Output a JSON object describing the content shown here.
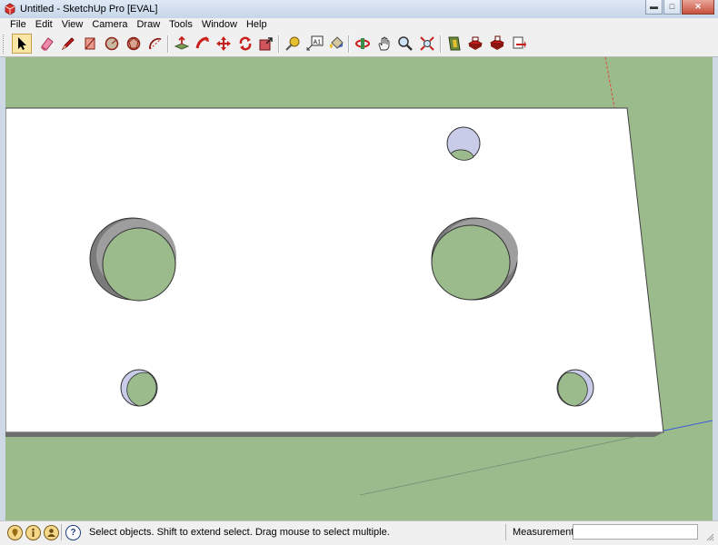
{
  "window": {
    "title": "Untitled - SketchUp Pro [EVAL]"
  },
  "menu": [
    "File",
    "Edit",
    "View",
    "Camera",
    "Draw",
    "Tools",
    "Window",
    "Help"
  ],
  "toolbar": {
    "tools": [
      {
        "name": "select-tool",
        "icon": "arrow-pointer-icon"
      },
      {
        "name": "eraser-tool",
        "icon": "eraser-icon"
      },
      {
        "name": "line-tool",
        "icon": "pencil-icon"
      },
      {
        "name": "rectangle-tool",
        "icon": "rectangle-icon"
      },
      {
        "name": "circle-tool",
        "icon": "circle-icon"
      },
      {
        "name": "polygon-tool",
        "icon": "polygon-icon"
      },
      {
        "name": "arc-tool",
        "icon": "arc-icon"
      },
      {
        "name": "push-pull-tool",
        "icon": "push-pull-icon"
      },
      {
        "name": "follow-me-tool",
        "icon": "follow-me-icon"
      },
      {
        "name": "move-tool",
        "icon": "move-icon"
      },
      {
        "name": "rotate-tool",
        "icon": "rotate-icon"
      },
      {
        "name": "scale-tool",
        "icon": "scale-icon"
      },
      {
        "name": "tape-measure-tool",
        "icon": "tape-measure-icon"
      },
      {
        "name": "text-tool",
        "icon": "text-label-icon"
      },
      {
        "name": "paint-bucket-tool",
        "icon": "paint-bucket-icon"
      },
      {
        "name": "orbit-tool",
        "icon": "orbit-icon"
      },
      {
        "name": "pan-tool",
        "icon": "hand-icon"
      },
      {
        "name": "zoom-tool",
        "icon": "magnifier-icon"
      },
      {
        "name": "zoom-extents-tool",
        "icon": "zoom-extents-icon"
      },
      {
        "name": "warehouse-tool",
        "icon": "warehouse-icon"
      },
      {
        "name": "share-model-tool",
        "icon": "share-model-icon"
      },
      {
        "name": "get-components-tool",
        "icon": "components-icon"
      },
      {
        "name": "send-to-layout-tool",
        "icon": "layout-icon"
      }
    ],
    "text_tool_label": "A1"
  },
  "status": {
    "message": "Select objects. Shift to extend select. Drag mouse to select multiple.",
    "measurements_label": "Measurements",
    "measurements_value": ""
  },
  "colors": {
    "ground": "#9cbb8d",
    "face": "#ffffff",
    "back_face": "#c8cce8",
    "accent_red": "#c8201c",
    "axis_red": "#d94a3a",
    "axis_blue": "#3a5bd9"
  }
}
